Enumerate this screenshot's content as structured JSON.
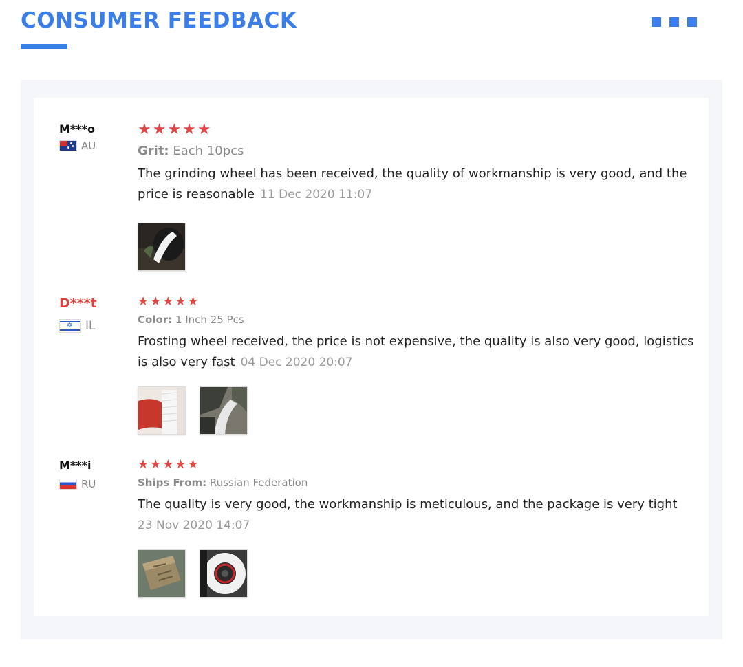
{
  "header": {
    "title": "CONSUMER FEEDBACK"
  },
  "reviews": [
    {
      "name": "M***o",
      "country": "AU",
      "stars": "★★★★★",
      "attribute_key": "Grit:",
      "attribute_value": "Each 10pcs",
      "text": "The grinding wheel has been received, the quality of workmanship is very good, and the price is reasonable",
      "date": "11 Dec 2020 11:07"
    },
    {
      "name": "D***t",
      "country": "IL",
      "stars": "★★★★★",
      "attribute_key": "Color:",
      "attribute_value": "1 Inch 25 Pcs",
      "text": "Frosting wheel received, the price is not expensive, the quality is also very good, logistics is also very fast",
      "date": "04 Dec 2020 20:07"
    },
    {
      "name": "M***i",
      "country": "RU",
      "stars": "★★★★★",
      "attribute_key": "Ships From:",
      "attribute_value": "Russian Federation",
      "text": "The quality is very good, the workmanship is meticulous, and the package is very tight",
      "date": "23 Nov 2020 14:07"
    }
  ],
  "colors": {
    "accent": "#3b7ee8",
    "star": "#e04848",
    "panel_bg": "#f4f6f9"
  },
  "icons": [
    "flag-au-icon",
    "flag-il-icon",
    "flag-ru-icon",
    "star-icon"
  ]
}
